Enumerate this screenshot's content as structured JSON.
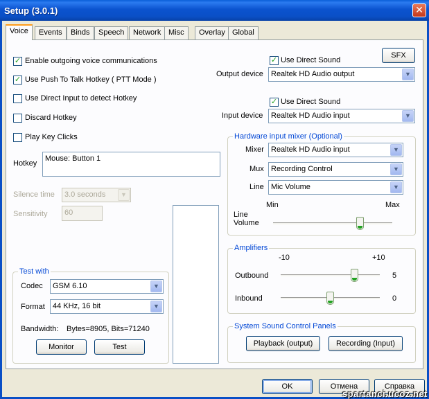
{
  "window": {
    "title": "Setup (3.0.1)",
    "close": "✕"
  },
  "tabs": [
    "Voice",
    "Events",
    "Binds",
    "Speech",
    "Network",
    "Misc",
    "Overlay",
    "Global"
  ],
  "left": {
    "enable_voice": {
      "label": "Enable outgoing voice communications",
      "checked": true
    },
    "push_to_talk": {
      "label": "Use Push To Talk Hotkey ( PTT Mode )",
      "checked": true
    },
    "direct_input": {
      "label": "Use Direct Input to detect Hotkey",
      "checked": false
    },
    "discard_hotkey": {
      "label": "Discard Hotkey",
      "checked": false
    },
    "key_clicks": {
      "label": "Play Key Clicks",
      "checked": false
    },
    "hotkey_label": "Hotkey",
    "hotkey_value": "Mouse: Button 1",
    "silence_label": "Silence time",
    "silence_value": "3.0 seconds",
    "sensitivity_label": "Sensitivity",
    "sensitivity_value": "60"
  },
  "test_with": {
    "title": "Test with",
    "codec_label": "Codec",
    "codec_value": "GSM 6.10",
    "format_label": "Format",
    "format_value": "44 KHz, 16 bit",
    "bandwidth_label": "Bandwidth:",
    "bandwidth_value": "Bytes=8905, Bits=71240",
    "monitor": "Monitor",
    "test": "Test"
  },
  "output": {
    "direct_sound": {
      "label": "Use Direct Sound",
      "checked": true
    },
    "sfx": "SFX",
    "device_label": "Output device",
    "device_value": "Realtek HD Audio output"
  },
  "input": {
    "direct_sound": {
      "label": "Use Direct Sound",
      "checked": true
    },
    "device_label": "Input device",
    "device_value": "Realtek HD Audio input"
  },
  "mixer": {
    "title": "Hardware input mixer (Optional)",
    "mixer_label": "Mixer",
    "mixer_value": "Realtek HD Audio input",
    "mux_label": "Mux",
    "mux_value": "Recording Control",
    "line_label": "Line",
    "line_value": "Mic Volume",
    "min": "Min",
    "max": "Max",
    "volume_label_1": "Line",
    "volume_label_2": "Volume",
    "volume_level": 0.73
  },
  "amplifiers": {
    "title": "Amplifiers",
    "min": "-10",
    "max": "+10",
    "outbound_label": "Outbound",
    "outbound_value": "5",
    "inbound_label": "Inbound",
    "inbound_value": "0"
  },
  "system_panels": {
    "title": "System Sound Control Panels",
    "playback": "Playback (output)",
    "recording": "Recording (Input)"
  },
  "footer": {
    "ok": "OK",
    "cancel": "Отмена",
    "help": "Справка"
  },
  "watermark": "spartanci.ucoz.net",
  "colors": {
    "titlebar": "#0a53cf",
    "group_title": "#0046d5",
    "check": "#21a121"
  }
}
